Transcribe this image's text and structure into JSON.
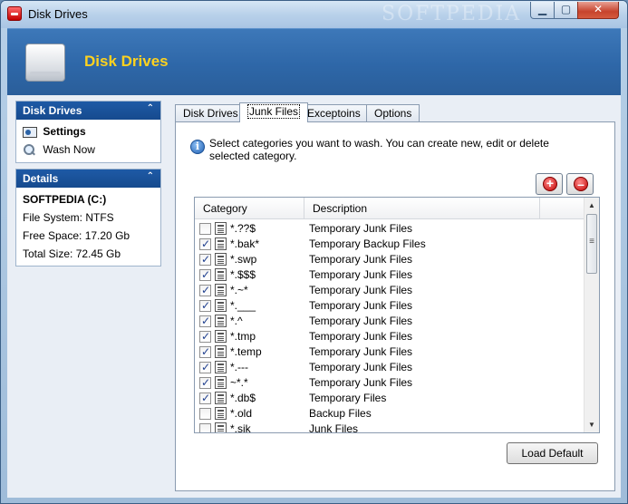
{
  "window": {
    "title": "Disk Drives",
    "watermark": "SOFTPEDIA",
    "min_glyph": "▁",
    "max_glyph": "▢",
    "close_glyph": "✕"
  },
  "banner": {
    "title": "Disk Drives"
  },
  "sidebar": {
    "disk_panel": {
      "title": "Disk Drives",
      "collapse_glyph": "⌃",
      "items": [
        {
          "label": "Settings",
          "icon": "settings-icon"
        },
        {
          "label": "Wash Now",
          "icon": "magnifier-icon"
        }
      ]
    },
    "details_panel": {
      "title": "Details",
      "collapse_glyph": "⌃",
      "drive": "SOFTPEDIA (C:)",
      "file_system": "File System: NTFS",
      "free_space": "Free Space: 17.20 Gb",
      "total_size": "Total Size: 72.45 Gb"
    }
  },
  "tabs": [
    {
      "label": "Disk Drives"
    },
    {
      "label": "Junk Files"
    },
    {
      "label": "Exceptoins"
    },
    {
      "label": "Options"
    }
  ],
  "junk_files": {
    "info": "Select categories you want to wash. You can create new, edit or delete selected category.",
    "columns": [
      "Category",
      "Description"
    ],
    "rows": [
      {
        "checked": false,
        "category": "*.??$",
        "description": "Temporary Junk Files"
      },
      {
        "checked": true,
        "category": "*.bak*",
        "description": "Temporary Backup Files"
      },
      {
        "checked": true,
        "category": "*.swp",
        "description": "Temporary Junk Files"
      },
      {
        "checked": true,
        "category": "*.$$$",
        "description": "Temporary Junk Files"
      },
      {
        "checked": true,
        "category": "*.~*",
        "description": "Temporary Junk Files"
      },
      {
        "checked": true,
        "category": "*.___",
        "description": "Temporary Junk Files"
      },
      {
        "checked": true,
        "category": "*.^",
        "description": "Temporary Junk Files"
      },
      {
        "checked": true,
        "category": "*.tmp",
        "description": "Temporary Junk Files"
      },
      {
        "checked": true,
        "category": "*.temp",
        "description": "Temporary Junk Files"
      },
      {
        "checked": true,
        "category": "*.---",
        "description": "Temporary Junk Files"
      },
      {
        "checked": true,
        "category": "~*.*",
        "description": "Temporary Junk Files"
      },
      {
        "checked": true,
        "category": "*.db$",
        "description": "Temporary Files"
      },
      {
        "checked": false,
        "category": "*.old",
        "description": "Backup Files"
      },
      {
        "checked": false,
        "category": "*.sik",
        "description": "Junk Files"
      }
    ],
    "load_default": "Load Default"
  }
}
